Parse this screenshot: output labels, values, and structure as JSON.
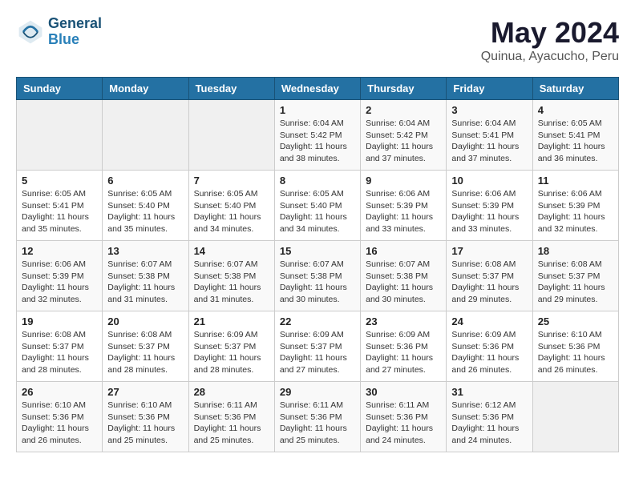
{
  "header": {
    "logo_line1": "General",
    "logo_line2": "Blue",
    "month": "May 2024",
    "location": "Quinua, Ayacucho, Peru"
  },
  "weekdays": [
    "Sunday",
    "Monday",
    "Tuesday",
    "Wednesday",
    "Thursday",
    "Friday",
    "Saturday"
  ],
  "weeks": [
    [
      {
        "day": "",
        "sunrise": "",
        "sunset": "",
        "daylight": ""
      },
      {
        "day": "",
        "sunrise": "",
        "sunset": "",
        "daylight": ""
      },
      {
        "day": "",
        "sunrise": "",
        "sunset": "",
        "daylight": ""
      },
      {
        "day": "1",
        "sunrise": "Sunrise: 6:04 AM",
        "sunset": "Sunset: 5:42 PM",
        "daylight": "Daylight: 11 hours and 38 minutes."
      },
      {
        "day": "2",
        "sunrise": "Sunrise: 6:04 AM",
        "sunset": "Sunset: 5:42 PM",
        "daylight": "Daylight: 11 hours and 37 minutes."
      },
      {
        "day": "3",
        "sunrise": "Sunrise: 6:04 AM",
        "sunset": "Sunset: 5:41 PM",
        "daylight": "Daylight: 11 hours and 37 minutes."
      },
      {
        "day": "4",
        "sunrise": "Sunrise: 6:05 AM",
        "sunset": "Sunset: 5:41 PM",
        "daylight": "Daylight: 11 hours and 36 minutes."
      }
    ],
    [
      {
        "day": "5",
        "sunrise": "Sunrise: 6:05 AM",
        "sunset": "Sunset: 5:41 PM",
        "daylight": "Daylight: 11 hours and 35 minutes."
      },
      {
        "day": "6",
        "sunrise": "Sunrise: 6:05 AM",
        "sunset": "Sunset: 5:40 PM",
        "daylight": "Daylight: 11 hours and 35 minutes."
      },
      {
        "day": "7",
        "sunrise": "Sunrise: 6:05 AM",
        "sunset": "Sunset: 5:40 PM",
        "daylight": "Daylight: 11 hours and 34 minutes."
      },
      {
        "day": "8",
        "sunrise": "Sunrise: 6:05 AM",
        "sunset": "Sunset: 5:40 PM",
        "daylight": "Daylight: 11 hours and 34 minutes."
      },
      {
        "day": "9",
        "sunrise": "Sunrise: 6:06 AM",
        "sunset": "Sunset: 5:39 PM",
        "daylight": "Daylight: 11 hours and 33 minutes."
      },
      {
        "day": "10",
        "sunrise": "Sunrise: 6:06 AM",
        "sunset": "Sunset: 5:39 PM",
        "daylight": "Daylight: 11 hours and 33 minutes."
      },
      {
        "day": "11",
        "sunrise": "Sunrise: 6:06 AM",
        "sunset": "Sunset: 5:39 PM",
        "daylight": "Daylight: 11 hours and 32 minutes."
      }
    ],
    [
      {
        "day": "12",
        "sunrise": "Sunrise: 6:06 AM",
        "sunset": "Sunset: 5:39 PM",
        "daylight": "Daylight: 11 hours and 32 minutes."
      },
      {
        "day": "13",
        "sunrise": "Sunrise: 6:07 AM",
        "sunset": "Sunset: 5:38 PM",
        "daylight": "Daylight: 11 hours and 31 minutes."
      },
      {
        "day": "14",
        "sunrise": "Sunrise: 6:07 AM",
        "sunset": "Sunset: 5:38 PM",
        "daylight": "Daylight: 11 hours and 31 minutes."
      },
      {
        "day": "15",
        "sunrise": "Sunrise: 6:07 AM",
        "sunset": "Sunset: 5:38 PM",
        "daylight": "Daylight: 11 hours and 30 minutes."
      },
      {
        "day": "16",
        "sunrise": "Sunrise: 6:07 AM",
        "sunset": "Sunset: 5:38 PM",
        "daylight": "Daylight: 11 hours and 30 minutes."
      },
      {
        "day": "17",
        "sunrise": "Sunrise: 6:08 AM",
        "sunset": "Sunset: 5:37 PM",
        "daylight": "Daylight: 11 hours and 29 minutes."
      },
      {
        "day": "18",
        "sunrise": "Sunrise: 6:08 AM",
        "sunset": "Sunset: 5:37 PM",
        "daylight": "Daylight: 11 hours and 29 minutes."
      }
    ],
    [
      {
        "day": "19",
        "sunrise": "Sunrise: 6:08 AM",
        "sunset": "Sunset: 5:37 PM",
        "daylight": "Daylight: 11 hours and 28 minutes."
      },
      {
        "day": "20",
        "sunrise": "Sunrise: 6:08 AM",
        "sunset": "Sunset: 5:37 PM",
        "daylight": "Daylight: 11 hours and 28 minutes."
      },
      {
        "day": "21",
        "sunrise": "Sunrise: 6:09 AM",
        "sunset": "Sunset: 5:37 PM",
        "daylight": "Daylight: 11 hours and 28 minutes."
      },
      {
        "day": "22",
        "sunrise": "Sunrise: 6:09 AM",
        "sunset": "Sunset: 5:37 PM",
        "daylight": "Daylight: 11 hours and 27 minutes."
      },
      {
        "day": "23",
        "sunrise": "Sunrise: 6:09 AM",
        "sunset": "Sunset: 5:36 PM",
        "daylight": "Daylight: 11 hours and 27 minutes."
      },
      {
        "day": "24",
        "sunrise": "Sunrise: 6:09 AM",
        "sunset": "Sunset: 5:36 PM",
        "daylight": "Daylight: 11 hours and 26 minutes."
      },
      {
        "day": "25",
        "sunrise": "Sunrise: 6:10 AM",
        "sunset": "Sunset: 5:36 PM",
        "daylight": "Daylight: 11 hours and 26 minutes."
      }
    ],
    [
      {
        "day": "26",
        "sunrise": "Sunrise: 6:10 AM",
        "sunset": "Sunset: 5:36 PM",
        "daylight": "Daylight: 11 hours and 26 minutes."
      },
      {
        "day": "27",
        "sunrise": "Sunrise: 6:10 AM",
        "sunset": "Sunset: 5:36 PM",
        "daylight": "Daylight: 11 hours and 25 minutes."
      },
      {
        "day": "28",
        "sunrise": "Sunrise: 6:11 AM",
        "sunset": "Sunset: 5:36 PM",
        "daylight": "Daylight: 11 hours and 25 minutes."
      },
      {
        "day": "29",
        "sunrise": "Sunrise: 6:11 AM",
        "sunset": "Sunset: 5:36 PM",
        "daylight": "Daylight: 11 hours and 25 minutes."
      },
      {
        "day": "30",
        "sunrise": "Sunrise: 6:11 AM",
        "sunset": "Sunset: 5:36 PM",
        "daylight": "Daylight: 11 hours and 24 minutes."
      },
      {
        "day": "31",
        "sunrise": "Sunrise: 6:12 AM",
        "sunset": "Sunset: 5:36 PM",
        "daylight": "Daylight: 11 hours and 24 minutes."
      },
      {
        "day": "",
        "sunrise": "",
        "sunset": "",
        "daylight": ""
      }
    ]
  ]
}
